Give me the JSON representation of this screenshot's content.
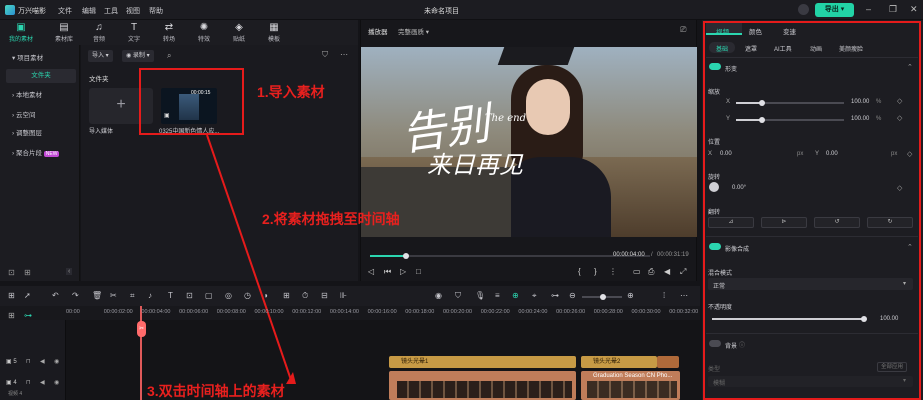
{
  "app": {
    "name": "万兴喵影",
    "project": "未命名项目",
    "export_label": "导出"
  },
  "menu": [
    "文件",
    "编辑",
    "工具",
    "视图",
    "帮助"
  ],
  "toolbar": [
    {
      "label": "我的素材",
      "icon": "folder-icon"
    },
    {
      "label": "素材库",
      "icon": "library-icon"
    },
    {
      "label": "音频",
      "icon": "music-icon"
    },
    {
      "label": "文字",
      "icon": "text-icon"
    },
    {
      "label": "转场",
      "icon": "transition-icon"
    },
    {
      "label": "特效",
      "icon": "effects-icon"
    },
    {
      "label": "贴纸",
      "icon": "sticker-icon"
    },
    {
      "label": "模板",
      "icon": "template-icon"
    }
  ],
  "sidebar": {
    "items": [
      "项目素材",
      "文件夹",
      "本地素材",
      "云空间",
      "调整图层",
      "聚合片段"
    ],
    "new_badge": "NEW"
  },
  "media": {
    "import_label": "导入",
    "record_label": "录制",
    "folder_label": "文件夹",
    "import_media_label": "导入媒体",
    "clip_name": "0325中国新色情人应...",
    "clip_duration": "00:00:15"
  },
  "annotations": [
    "1.导入素材",
    "2.将素材拖拽至时间轴",
    "3.双击时间轴上的素材"
  ],
  "player": {
    "label": "播放器",
    "quality": "完整画质",
    "current_time": "00:00:04:00",
    "total_time": "00:00:31:19",
    "progress": 0.13,
    "overlay_title": "告别",
    "overlay_sub": "来日再见",
    "overlay_en": "The end"
  },
  "props": {
    "tabs": [
      "视频",
      "颜色",
      "变速"
    ],
    "subtabs": [
      "基础",
      "遮罩",
      "AI工具",
      "动画",
      "美颜瘦脸"
    ],
    "transform": "形变",
    "scale": "缩放",
    "scale_x": "100.00",
    "scale_y": "100.00",
    "pct": "%",
    "position": "位置",
    "pos_x": "0.00",
    "pos_y": "0.00",
    "px": "px",
    "rotate": "旋转",
    "rotate_val": "0.00°",
    "flip": "翻转",
    "compositing": "影像合成",
    "blend_mode_label": "混合模式",
    "blend_mode": "正常",
    "opacity_label": "不透明度",
    "opacity": "100.00",
    "opacity_level": 1.0,
    "background": "背景",
    "type_label": "类型",
    "apply_all": "全部应用",
    "blur_label": "模糊"
  },
  "timeline": {
    "ruler": [
      "00:00",
      "00:00:02:00",
      "00:00:04:00",
      "00:00:06:00",
      "00:00:08:00",
      "00:00:10:00",
      "00:00:12:00",
      "00:00:14:00",
      "00:00:16:00",
      "00:00:18:00",
      "00:00:20:00",
      "00:00:22:00",
      "00:00:24:00",
      "00:00:26:00",
      "00:00:28:00",
      "00:00:30:00",
      "00:00:32:00"
    ],
    "fx_clips": [
      "镜头光晕1",
      "镜头光晕2"
    ],
    "video_clip": "Graduation Season CN Pho...",
    "track_label": "视频 4"
  },
  "colors": {
    "accent": "#22d3a6",
    "annotation": "#e51b1b"
  }
}
